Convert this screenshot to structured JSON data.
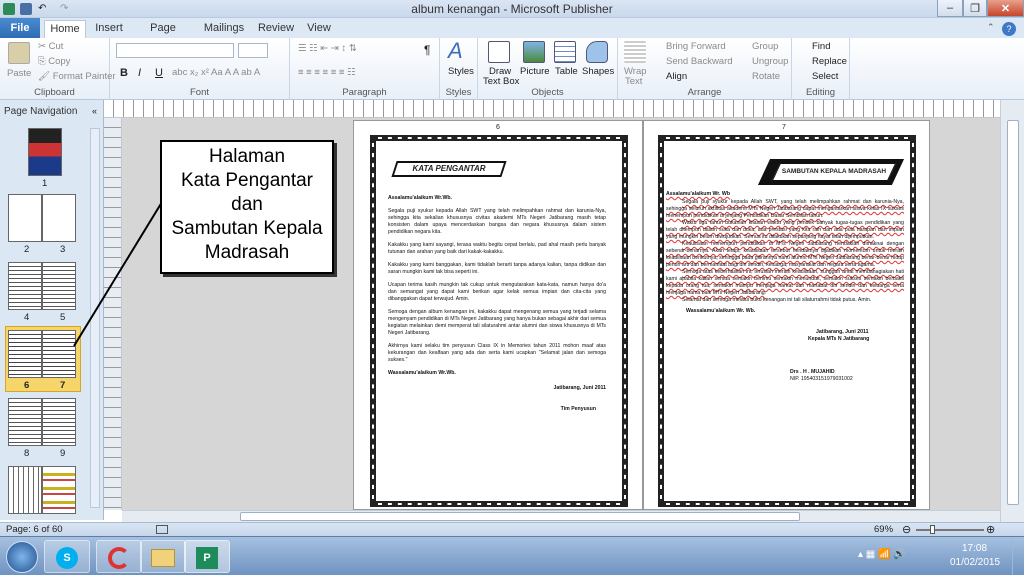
{
  "window": {
    "title": "album kenangan  -  Microsoft Publisher"
  },
  "tabs": [
    "File",
    "Home",
    "Insert",
    "Page Design",
    "Mailings",
    "Review",
    "View"
  ],
  "ribbon": {
    "clipboard": {
      "paste": "Paste",
      "cut": "Cut",
      "copy": "Copy",
      "format_painter": "Format Painter",
      "label": "Clipboard"
    },
    "font": {
      "label": "Font",
      "bold": "B",
      "italic": "I",
      "underline": "U"
    },
    "paragraph": {
      "label": "Paragraph",
      "pilcrow": "¶"
    },
    "styles": {
      "button": "Styles",
      "label": "Styles"
    },
    "objects": {
      "draw_text_box_1": "Draw",
      "draw_text_box_2": "Text Box",
      "picture": "Picture",
      "table": "Table",
      "shapes": "Shapes",
      "label": "Objects"
    },
    "arrange": {
      "wrap_text_1": "Wrap",
      "wrap_text_2": "Text",
      "bring_forward": "Bring Forward",
      "send_backward": "Send Backward",
      "align": "Align",
      "group": "Group",
      "ungroup": "Ungroup",
      "rotate": "Rotate",
      "label": "Arrange"
    },
    "editing": {
      "find": "Find",
      "replace": "Replace",
      "select": "Select",
      "label": "Editing"
    }
  },
  "page_navigation": {
    "header": "Page Navigation",
    "pages": [
      "1",
      "2",
      "3",
      "4",
      "5",
      "6",
      "7",
      "8",
      "9"
    ]
  },
  "callout": {
    "line1": "Halaman",
    "line2": "Kata Pengantar",
    "line3": "dan",
    "line4": "Sambutan Kepala",
    "line5": "Madrasah"
  },
  "left_page": {
    "number": "6",
    "banner": "KATA PENGANTAR",
    "greeting": "Assalamu'alaikum Wr.Wb.",
    "paragraphs": [
      "Segala puji syukur kepada Allah SWT yang telah melimpahkan rahmat dan karunia-Nya, sehingga kita sekalian khususnya civitas akademi MTs Negeri Jatibarang masih tetap konsisten dalam upaya mencerdaskan bangsa dan negara khususnya dalam sistem pendidikan negara kita.",
      "Kakakku yang kami sayangi, terasa waktu begitu cepat berlalu, pad ahal masih perlu banyak tutunan dan arahan yang baik dari kakak-kakakku.",
      "Kakakku yang kami banggakan, kami tidaklah berarti tanpa adanya kalian, tanpa didikan dan saran mungkin kami tak bisa seperti ini.",
      "Ucapan terima kasih mungkin tak cukup untuk mengutarakan kata-kata, namun hanya do'a dan semangat yang dapat kami berikan agar kelak semua impian dan cita-cita yang dibanggakan dapat terwujud. Amin.",
      "Semoga dengan album kenangan ini, kakakku dapat mengenang semua yang terjadi selama mengenyam pendidikan di MTs Negeri Jatibarang yang hanya bukan sebagai akhir dari semua kegiatan melainkan demi memperat tali silaturahmi antar alumni dan siswa khususnya di MTs Negeri Jatibarang.",
      "Akhirnya kami selaku tim penyusun Class IX in Memories tahun 2011 mohon maaf atas kekurangan dan kealfaan yang ada dan serta kami ucapkan \"Selamat jalan dan semoga sukses.\""
    ],
    "closing": "Wassalamu'alaikum Wr.Wb.",
    "place_date": "Jatibarang,    Juni 2011",
    "signature": "Tim Penyusun"
  },
  "right_page": {
    "number": "7",
    "banner": "SAMBUTAN KEPALA MADRASAH",
    "greeting": "Assalamu'alaikum  Wr. Wb",
    "paragraphs": [
      "Segala puji syukur kepada Allah SWT, yang telah melimpahkan rahmat dan karunia-Nya, sehingga seluruh aktifitas akademi MTs Negeri Jatibarang dapat mengantarkan siswa kelas IX sukses menempuh pendidikan di jenjang Pendidikan Dasar Sembilan tahun.",
      "Waktu tiga tahun bukanlah kilasan waktu yang pendek banyak tugas-tugas pendidikan yang telah ditempuh dalam suka dan duka, ada prestasi yang kita raih dan ada pula harapan dan impian yang mungkin belum diwujudkan. Semua itu dilakukan sepanjang hayat telah dijemputkan.",
      "Keaulisaan menempuh pendidikan di MTs Negeri Jatibarang hendaklah dimaknai dengan sebenar-benarnya. Akan tetapi, keaulisaan tersebut hendaknya dijadikan momentum untuk meraih keaulisaan berikutnya, sehingga pada gilirannya nanti alumni MTs Negeri Jatibarang benar-benar hidup penuh arti dan bermanfaat bagi diri sendiri, keluarga, masyarakat dan negara serta agama.",
      "Semoga atas keberhasilan ini, teruslah meraih keaulisaan, sungguh amat membahagiakan hati kami apabila kalian semua semakin berilmu semakin menunduk, semakin sukses semakin berbakti kepada orang tua, semakin mampu menjaga harkat dan martabat diri sendiri dan keluarga serta menjaga nama baik MTs Negeri Jatibarang.",
      "Selamat dan semoga melalui buku kenangan ini tali silaturrahmi tidak putus. Amin."
    ],
    "closing": "Wassalamu'alaikum  Wr. Wb.",
    "place_date": "Jatibarang,    Juni 2011",
    "office": "Kepala MTs N Jatibarang",
    "name": "Drs . H . MUJAHID",
    "nip": "NIP. 195403151979031002"
  },
  "status": {
    "page": "Page: 6 of 60",
    "zoom": "69%"
  },
  "taskbar": {
    "time": "17:08",
    "date": "01/02/2015"
  },
  "colors": {
    "ribbon_blue": "#2e6cb4",
    "selected_thumb": "#f6d66b",
    "workspace": "#d6d6d6"
  }
}
